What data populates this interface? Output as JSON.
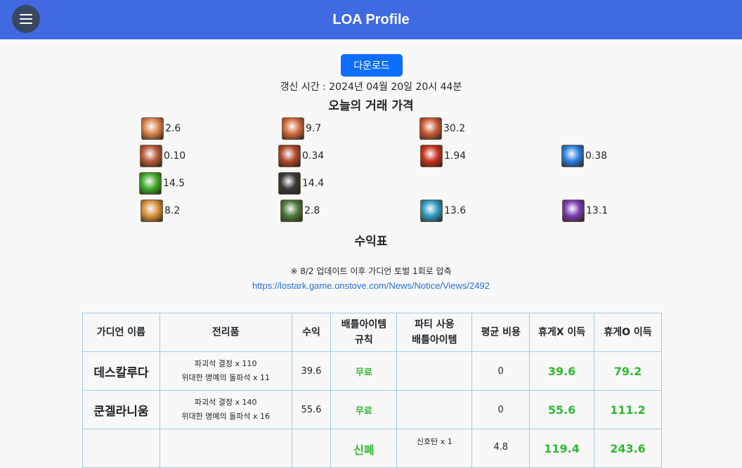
{
  "header": {
    "title": "LOA Profile"
  },
  "download_label": "다운로드",
  "updated_text": "갱신 시간 : 2024년 04월 20일 20시 44분",
  "price_heading": "오늘의 거래 가격",
  "prices": [
    {
      "icon": "guardian-stone-fragment-icon",
      "color": "#d9824a",
      "value": "2.6"
    },
    {
      "icon": "guardian-stone-icon",
      "color": "#d26a3a",
      "value": "9.7"
    },
    {
      "icon": "guardian-stone-crystal-icon",
      "color": "#c85a34",
      "value": "30.2"
    },
    {
      "icon": "destruction-stone-fragment-icon",
      "color": "#b85a3a",
      "value": "0.10"
    },
    {
      "icon": "destruction-stone-icon",
      "color": "#b0482e",
      "value": "0.34"
    },
    {
      "icon": "destruction-stone-crystal-icon",
      "color": "#c8321e",
      "value": "1.94"
    },
    {
      "icon": "blue-crystal-icon",
      "color": "#2a7de0",
      "value": "0.38"
    },
    {
      "icon": "green-potion-icon",
      "color": "#3eaa2a",
      "value": "14.5"
    },
    {
      "icon": "black-bomb-icon",
      "color": "#3a3a3a",
      "value": "14.4"
    },
    {
      "icon": "orange-flask-icon",
      "color": "#d8903a",
      "value": "8.2"
    },
    {
      "icon": "green-grenade-icon",
      "color": "#4a7a3a",
      "value": "2.8"
    },
    {
      "icon": "blue-grenade-icon",
      "color": "#2a9ac0",
      "value": "13.6"
    },
    {
      "icon": "purple-potion-icon",
      "color": "#7a3ab0",
      "value": "13.1"
    }
  ],
  "profit_heading": "수익표",
  "note": "※ 8/2 업데이트 이후 가디언 토벌 1회로 압축",
  "notice_link": "https://lostark.game.onstove.com/News/Notice/Views/2492",
  "table": {
    "headers": [
      "가디언 이름",
      "전리품",
      "수익",
      "배틀아이템 규칙",
      "파티 사용 배틀아이템",
      "평균 비용",
      "휴게X 이득",
      "휴게O 이득"
    ],
    "rows": [
      {
        "name": "데스칼루다",
        "loot1": "파괴석 결정 x 110",
        "loot2": "위대한 명예의 돌파석 x 11",
        "profit": "39.6",
        "rule": "무료",
        "items1": "",
        "items2": "",
        "cost": "0",
        "gainx": "39.6",
        "gaino": "79.2"
      },
      {
        "name": "쿤겔라니움",
        "loot1": "파괴석 결정 x 140",
        "loot2": "위대한 명예의 돌파석 x 16",
        "profit": "55.6",
        "rule": "무료",
        "items1": "",
        "items2": "",
        "cost": "0",
        "gainx": "55.6",
        "gaino": "111.2"
      },
      {
        "name": "",
        "loot1": "",
        "loot2": "",
        "profit": "",
        "rule": "신폐",
        "items1": "신호탄 x 1",
        "items2": "",
        "cost": "4.8",
        "gainx": "119.4",
        "gaino": "243.6"
      }
    ]
  }
}
